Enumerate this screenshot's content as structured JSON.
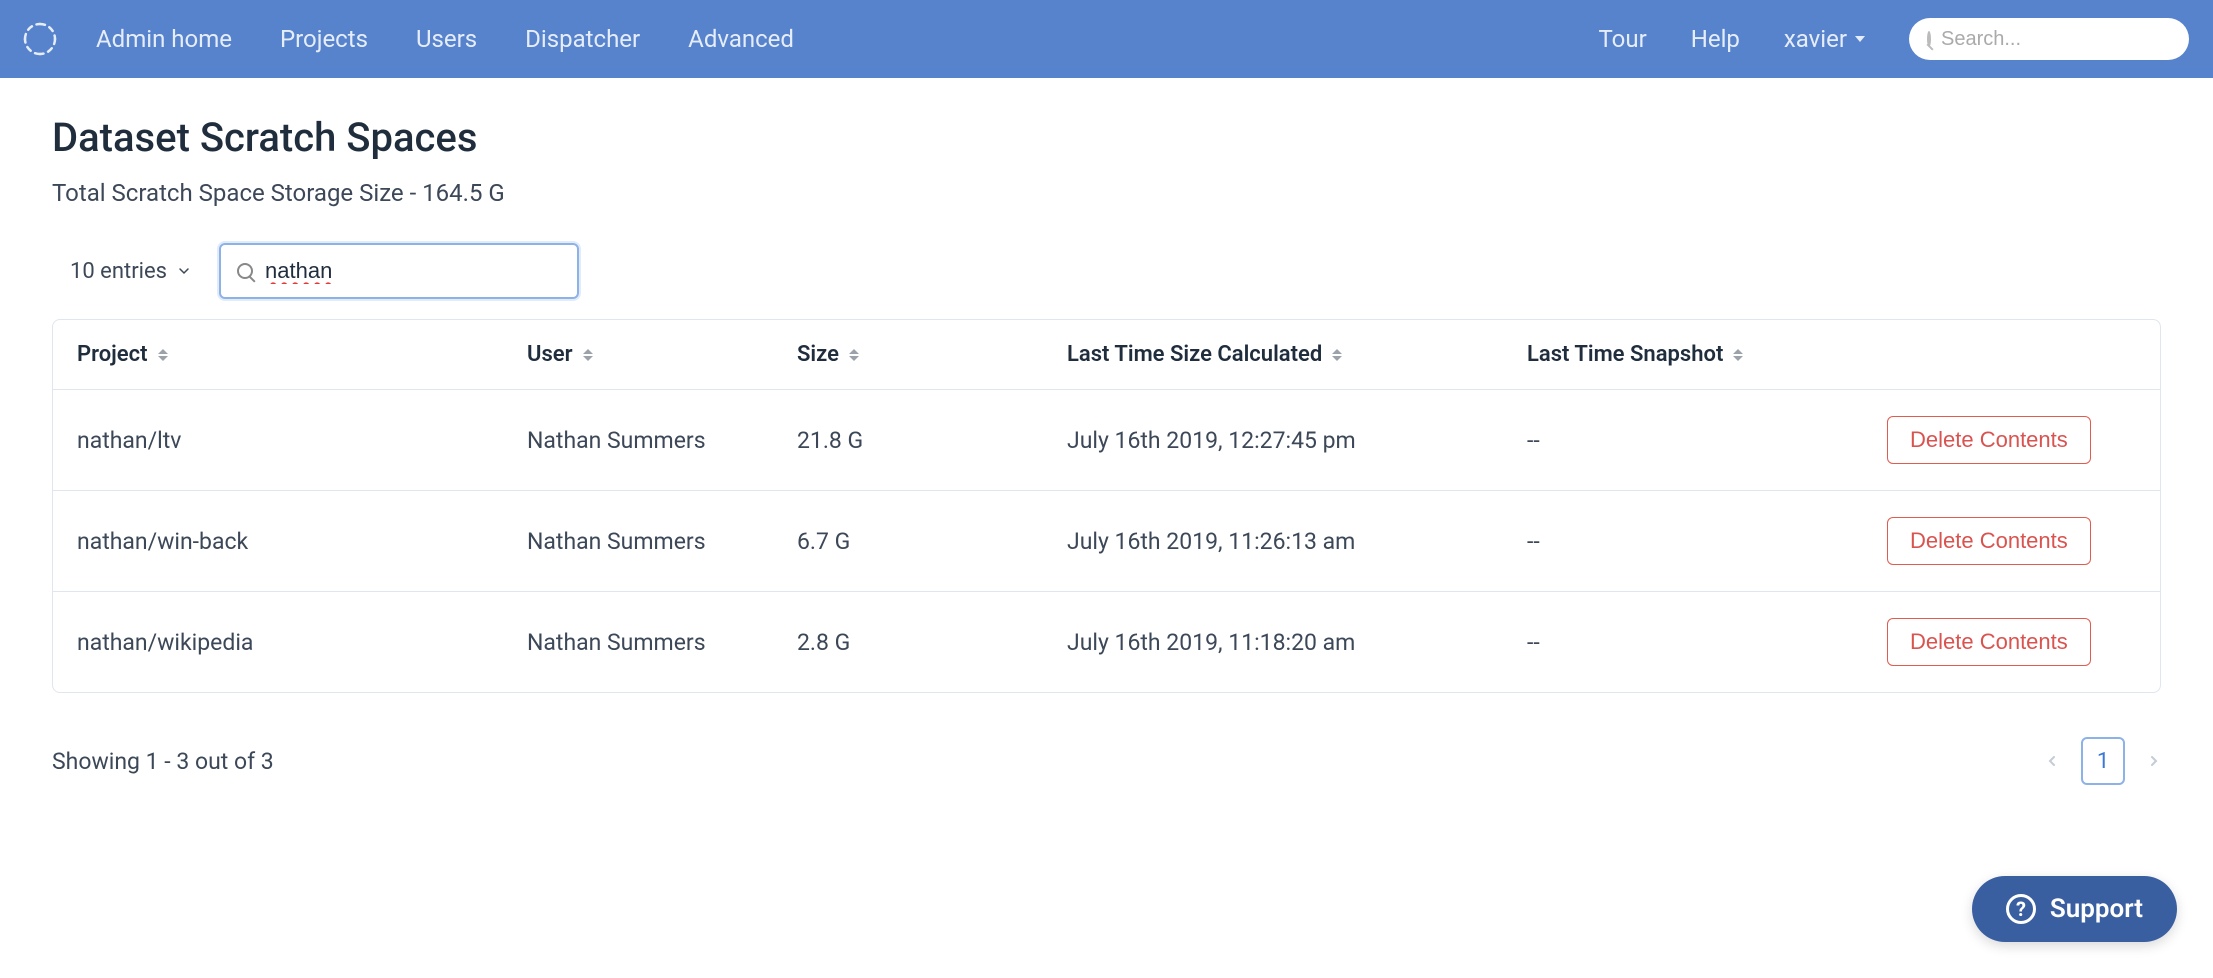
{
  "nav": {
    "links": [
      "Admin home",
      "Projects",
      "Users",
      "Dispatcher",
      "Advanced"
    ],
    "right": {
      "tour": "Tour",
      "help": "Help",
      "user": "xavier"
    },
    "search_placeholder": "Search..."
  },
  "page": {
    "title": "Dataset Scratch Spaces",
    "subtitle": "Total Scratch Space Storage Size - 164.5 G"
  },
  "controls": {
    "entries_label": "10 entries",
    "search_value": "nathan"
  },
  "table": {
    "headers": {
      "project": "Project",
      "user": "User",
      "size": "Size",
      "calc": "Last Time Size Calculated",
      "snap": "Last Time Snapshot"
    },
    "rows": [
      {
        "project": "nathan/ltv",
        "user": "Nathan Summers",
        "size": "21.8 G",
        "calc": "July 16th 2019, 12:27:45 pm",
        "snap": "--",
        "action": "Delete Contents"
      },
      {
        "project": "nathan/win-back",
        "user": "Nathan Summers",
        "size": "6.7 G",
        "calc": "July 16th 2019, 11:26:13 am",
        "snap": "--",
        "action": "Delete Contents"
      },
      {
        "project": "nathan/wikipedia",
        "user": "Nathan Summers",
        "size": "2.8 G",
        "calc": "July 16th 2019, 11:18:20 am",
        "snap": "--",
        "action": "Delete Contents"
      }
    ]
  },
  "footer": {
    "showing": "Showing 1 - 3 out of 3",
    "page": "1"
  },
  "support": {
    "label": "Support"
  }
}
